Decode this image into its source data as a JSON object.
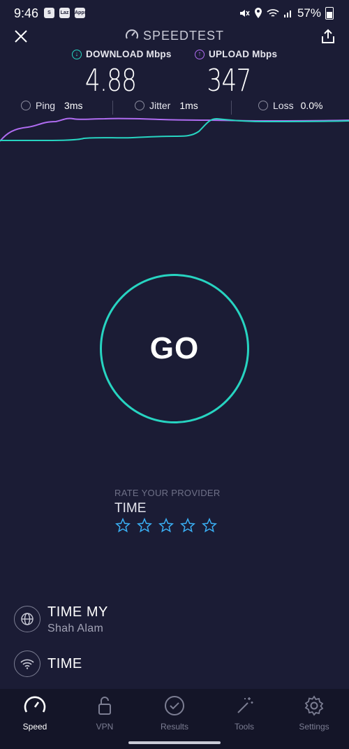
{
  "status_bar": {
    "time": "9:46",
    "battery": "57%",
    "app_badges": [
      "S",
      "Laz",
      "Apps"
    ]
  },
  "header": {
    "title": "SPEEDTEST"
  },
  "metrics": {
    "download_label": "DOWNLOAD Mbps",
    "download_value": "4.88",
    "upload_label": "UPLOAD Mbps",
    "upload_value": "347"
  },
  "stats": {
    "ping_label": "Ping",
    "ping_value": "3ms",
    "jitter_label": "Jitter",
    "jitter_value": "1ms",
    "loss_label": "Loss",
    "loss_value": "0.0%"
  },
  "go_button": {
    "label": "GO"
  },
  "rating": {
    "title": "RATE YOUR PROVIDER",
    "provider": "TIME",
    "stars": 5
  },
  "connection": {
    "isp_name": "TIME MY",
    "isp_location": "Shah Alam",
    "wifi_name": "TIME"
  },
  "nav": {
    "items": [
      {
        "label": "Speed",
        "active": true
      },
      {
        "label": "VPN"
      },
      {
        "label": "Results"
      },
      {
        "label": "Tools"
      },
      {
        "label": "Settings"
      }
    ]
  },
  "colors": {
    "background": "#1b1c35",
    "download_accent": "#27d4c1",
    "upload_accent": "#b06cf2",
    "star": "#3ab0f5"
  }
}
